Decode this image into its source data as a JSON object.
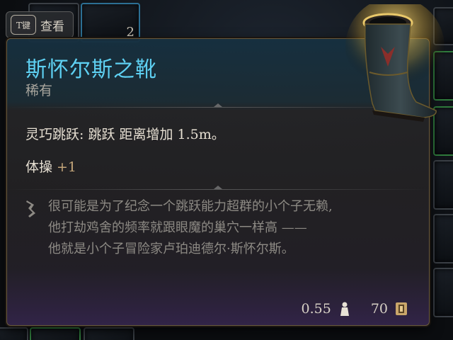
{
  "hint": {
    "key": "T键",
    "label": "查看"
  },
  "background_slots": {
    "count_label": "2"
  },
  "item": {
    "name": "斯怀尔斯之靴",
    "rarity": "稀有",
    "effect": "灵巧跳跃: 跳跃 距离增加 1.5m。",
    "attribute": {
      "name": "体操",
      "bonus": "+1"
    },
    "flavor_lines": [
      "很可能是为了纪念一个跳跃能力超群的小个子无赖,",
      "他打劫鸡舍的频率就跟眼魔的巢穴一样高 ——",
      "他就是小个子冒险家卢珀迪德尔·斯怀尔斯。"
    ],
    "weight": "0.55",
    "value": "70"
  },
  "colors": {
    "title": "#5ed0f2",
    "bonus": "#c4a67a",
    "flavor": "#8d8a84",
    "rare_border": "#2c6f93"
  },
  "icons": [
    "key-icon",
    "quill-icon",
    "weight-icon",
    "coin-icon",
    "boots-icon"
  ]
}
